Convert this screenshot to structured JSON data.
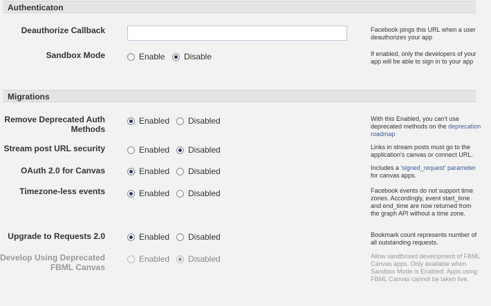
{
  "sections": {
    "authentication": "Authenticaton",
    "migrations": "Migrations"
  },
  "auth": {
    "deauthorize": {
      "label": "Deauthorize Callback",
      "value": "",
      "help": "Facebook pings this URL when a user deauthorizes your app"
    },
    "sandbox": {
      "label": "Sandbox Mode",
      "opt1": "Enable",
      "opt2": "Disable",
      "selected": "Disable",
      "help": "If enabled, only the developers of your app will be able to sign in to your app"
    }
  },
  "migrations": {
    "remove_deprecated": {
      "label": "Remove Deprecated Auth Methods",
      "opt1": "Enabled",
      "opt2": "Disabled",
      "selected": "Enabled",
      "help_text": "With this Enabled, you can't use deprecated methods on the ",
      "help_link": "deprecation roadmap"
    },
    "stream_post": {
      "label": "Stream post URL security",
      "opt1": "Enabled",
      "opt2": "Disabled",
      "selected": "Disabled",
      "help": "Links in stream posts must go to the application's canvas or connect URL."
    },
    "oauth_canvas": {
      "label": "OAuth 2.0 for Canvas",
      "opt1": "Enabled",
      "opt2": "Disabled",
      "selected": "Enabled",
      "help_text": "Includes a ",
      "help_link": "'signed_request' parameter",
      "help_text2": " for canvas apps."
    },
    "timezone": {
      "label": "Timezone-less events",
      "opt1": "Enabled",
      "opt2": "Disabled",
      "selected": "Enabled",
      "help": "Facebook events do not support time zones. Accordingly, event start_time and end_time are now returned from the graph API without a time zone."
    },
    "requests": {
      "label": "Upgrade to Requests 2.0",
      "opt1": "Enabled",
      "opt2": "Disabled",
      "selected": "Enabled",
      "help": "Bookmark count represents number of all outstanding requests."
    },
    "fbml": {
      "label": "Develop Using Deprecated FBML Canvas",
      "opt1": "Enabled",
      "opt2": "Disabled",
      "selected": "Disabled",
      "help": "Allow sandboxed development of FBML Canvas apps. Only available when Sandbox Mode is Enabled. Apps using FBML Canvas cannot be taken live."
    }
  }
}
